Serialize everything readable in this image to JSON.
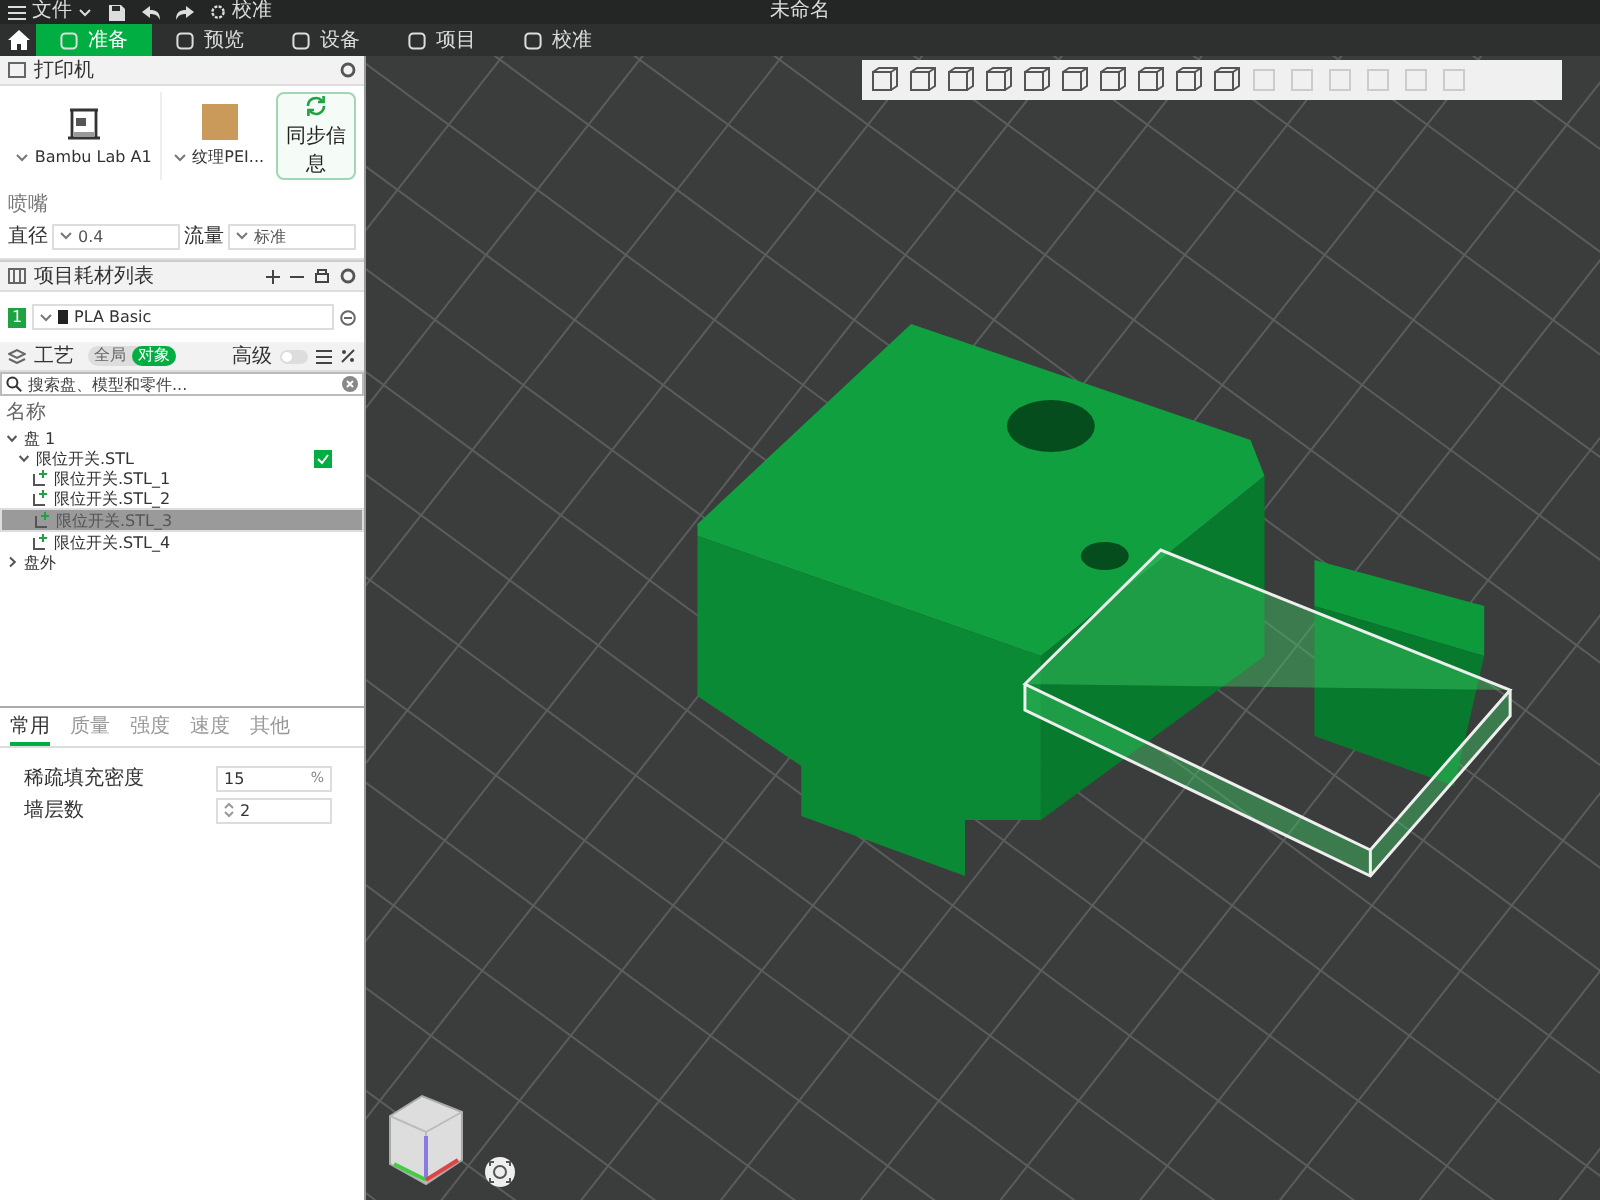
{
  "menubar": {
    "menu_label": "文件",
    "calibrate_label": "校准"
  },
  "window": {
    "title": "未命名"
  },
  "tabs": [
    {
      "label": "准备",
      "selected": true
    },
    {
      "label": "预览",
      "selected": false
    },
    {
      "label": "设备",
      "selected": false
    },
    {
      "label": "项目",
      "selected": false
    },
    {
      "label": "校准",
      "selected": false
    }
  ],
  "printer": {
    "title": "打印机",
    "name": "Bambu Lab A1",
    "plate": "纹理PEI...",
    "sync_button": "同步信息",
    "nozzle_title": "喷嘴",
    "diameter_label": "直径",
    "diameter_value": "0.4",
    "flow_label": "流量",
    "flow_value": "标准"
  },
  "filaments": {
    "title": "项目耗材列表",
    "items": [
      {
        "index": "1",
        "name": "PLA Basic",
        "color": "#1fa342"
      }
    ]
  },
  "process": {
    "title": "工艺",
    "scopes": [
      {
        "label": "全局",
        "selected": false
      },
      {
        "label": "对象",
        "selected": true
      }
    ],
    "advanced_label": "高级",
    "advanced_on": false
  },
  "search": {
    "placeholder": "搜索盘、模型和零件..."
  },
  "objects": {
    "header": "名称",
    "tree": [
      {
        "label": "盘 1",
        "expanded": true,
        "children": [
          {
            "label": "限位开关.STL",
            "expanded": true,
            "checked": true,
            "children": [
              {
                "label": "限位开关.STL_1",
                "selected": false
              },
              {
                "label": "限位开关.STL_2",
                "selected": false
              },
              {
                "label": "限位开关.STL_3",
                "selected": true
              },
              {
                "label": "限位开关.STL_4",
                "selected": false
              }
            ]
          }
        ]
      },
      {
        "label": "盘外",
        "expanded": false
      }
    ]
  },
  "settings": {
    "tabs": [
      {
        "label": "常用",
        "selected": true
      },
      {
        "label": "质量",
        "selected": false
      },
      {
        "label": "强度",
        "selected": false
      },
      {
        "label": "速度",
        "selected": false
      },
      {
        "label": "其他",
        "selected": false
      }
    ],
    "fields": [
      {
        "kind": "unit",
        "label": "稀疏填充密度",
        "value": "15",
        "unit": "%"
      },
      {
        "kind": "spin",
        "label": "墙层数",
        "value": "2"
      }
    ]
  }
}
